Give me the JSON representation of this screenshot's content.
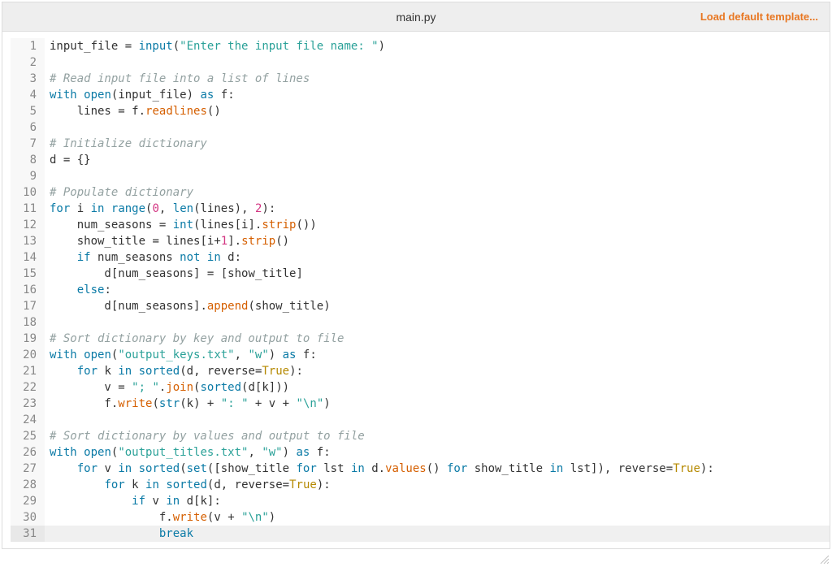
{
  "header": {
    "title": "main.py",
    "load_link": "Load default template..."
  },
  "editor": {
    "active_line": 31,
    "lines": [
      {
        "n": 1,
        "t": [
          [
            "",
            "input_file "
          ],
          [
            "op",
            "= "
          ],
          [
            "bi",
            "input"
          ],
          [
            "op",
            "("
          ],
          [
            "str",
            "\"Enter the input file name: \""
          ],
          [
            "op",
            ")"
          ]
        ]
      },
      {
        "n": 2,
        "t": [
          [
            "",
            ""
          ]
        ]
      },
      {
        "n": 3,
        "t": [
          [
            "com",
            "# Read input file into a list of lines"
          ]
        ]
      },
      {
        "n": 4,
        "t": [
          [
            "kw",
            "with"
          ],
          [
            "",
            " "
          ],
          [
            "bi",
            "open"
          ],
          [
            "op",
            "("
          ],
          [
            "",
            "input_file"
          ],
          [
            "op",
            ") "
          ],
          [
            "kw",
            "as"
          ],
          [
            "",
            " f"
          ],
          [
            "op",
            ":"
          ]
        ]
      },
      {
        "n": 5,
        "t": [
          [
            "",
            "    lines "
          ],
          [
            "op",
            "= "
          ],
          [
            "",
            "f"
          ],
          [
            "op",
            "."
          ],
          [
            "fn",
            "readlines"
          ],
          [
            "op",
            "()"
          ]
        ]
      },
      {
        "n": 6,
        "t": [
          [
            "",
            ""
          ]
        ]
      },
      {
        "n": 7,
        "t": [
          [
            "com",
            "# Initialize dictionary"
          ]
        ]
      },
      {
        "n": 8,
        "t": [
          [
            "",
            "d "
          ],
          [
            "op",
            "= {}"
          ]
        ]
      },
      {
        "n": 9,
        "t": [
          [
            "",
            ""
          ]
        ]
      },
      {
        "n": 10,
        "t": [
          [
            "com",
            "# Populate dictionary"
          ]
        ]
      },
      {
        "n": 11,
        "t": [
          [
            "kw",
            "for"
          ],
          [
            "",
            " i "
          ],
          [
            "kw",
            "in"
          ],
          [
            "",
            " "
          ],
          [
            "bi",
            "range"
          ],
          [
            "op",
            "("
          ],
          [
            "num",
            "0"
          ],
          [
            "op",
            ", "
          ],
          [
            "bi",
            "len"
          ],
          [
            "op",
            "("
          ],
          [
            "",
            "lines"
          ],
          [
            "op",
            "), "
          ],
          [
            "num",
            "2"
          ],
          [
            "op",
            "):"
          ]
        ]
      },
      {
        "n": 12,
        "t": [
          [
            "",
            "    num_seasons "
          ],
          [
            "op",
            "= "
          ],
          [
            "bi",
            "int"
          ],
          [
            "op",
            "("
          ],
          [
            "",
            "lines"
          ],
          [
            "op",
            "["
          ],
          [
            "",
            "i"
          ],
          [
            "op",
            "]."
          ],
          [
            "fn",
            "strip"
          ],
          [
            "op",
            "())"
          ]
        ]
      },
      {
        "n": 13,
        "t": [
          [
            "",
            "    show_title "
          ],
          [
            "op",
            "= "
          ],
          [
            "",
            "lines"
          ],
          [
            "op",
            "["
          ],
          [
            "",
            "i"
          ],
          [
            "op",
            "+"
          ],
          [
            "num",
            "1"
          ],
          [
            "op",
            "]."
          ],
          [
            "fn",
            "strip"
          ],
          [
            "op",
            "()"
          ]
        ]
      },
      {
        "n": 14,
        "t": [
          [
            "",
            "    "
          ],
          [
            "kw",
            "if"
          ],
          [
            "",
            " num_seasons "
          ],
          [
            "kw",
            "not"
          ],
          [
            "",
            " "
          ],
          [
            "kw",
            "in"
          ],
          [
            "",
            " d"
          ],
          [
            "op",
            ":"
          ]
        ]
      },
      {
        "n": 15,
        "t": [
          [
            "",
            "        d"
          ],
          [
            "op",
            "["
          ],
          [
            "",
            "num_seasons"
          ],
          [
            "op",
            "] = ["
          ],
          [
            "",
            "show_title"
          ],
          [
            "op",
            "]"
          ]
        ]
      },
      {
        "n": 16,
        "t": [
          [
            "",
            "    "
          ],
          [
            "kw",
            "else"
          ],
          [
            "op",
            ":"
          ]
        ]
      },
      {
        "n": 17,
        "t": [
          [
            "",
            "        d"
          ],
          [
            "op",
            "["
          ],
          [
            "",
            "num_seasons"
          ],
          [
            "op",
            "]."
          ],
          [
            "fn",
            "append"
          ],
          [
            "op",
            "("
          ],
          [
            "",
            "show_title"
          ],
          [
            "op",
            ")"
          ]
        ]
      },
      {
        "n": 18,
        "t": [
          [
            "",
            ""
          ]
        ]
      },
      {
        "n": 19,
        "t": [
          [
            "com",
            "# Sort dictionary by key and output to file"
          ]
        ]
      },
      {
        "n": 20,
        "t": [
          [
            "kw",
            "with"
          ],
          [
            "",
            " "
          ],
          [
            "bi",
            "open"
          ],
          [
            "op",
            "("
          ],
          [
            "str",
            "\"output_keys.txt\""
          ],
          [
            "op",
            ", "
          ],
          [
            "str",
            "\"w\""
          ],
          [
            "op",
            ") "
          ],
          [
            "kw",
            "as"
          ],
          [
            "",
            " f"
          ],
          [
            "op",
            ":"
          ]
        ]
      },
      {
        "n": 21,
        "t": [
          [
            "",
            "    "
          ],
          [
            "kw",
            "for"
          ],
          [
            "",
            " k "
          ],
          [
            "kw",
            "in"
          ],
          [
            "",
            " "
          ],
          [
            "bi",
            "sorted"
          ],
          [
            "op",
            "("
          ],
          [
            "",
            "d"
          ],
          [
            "op",
            ", "
          ],
          [
            "",
            "reverse"
          ],
          [
            "op",
            "="
          ],
          [
            "bool",
            "True"
          ],
          [
            "op",
            "):"
          ]
        ]
      },
      {
        "n": 22,
        "t": [
          [
            "",
            "        v "
          ],
          [
            "op",
            "= "
          ],
          [
            "str",
            "\"; \""
          ],
          [
            "op",
            "."
          ],
          [
            "fn",
            "join"
          ],
          [
            "op",
            "("
          ],
          [
            "bi",
            "sorted"
          ],
          [
            "op",
            "("
          ],
          [
            "",
            "d"
          ],
          [
            "op",
            "["
          ],
          [
            "",
            "k"
          ],
          [
            "op",
            "]))"
          ]
        ]
      },
      {
        "n": 23,
        "t": [
          [
            "",
            "        f"
          ],
          [
            "op",
            "."
          ],
          [
            "fn",
            "write"
          ],
          [
            "op",
            "("
          ],
          [
            "bi",
            "str"
          ],
          [
            "op",
            "("
          ],
          [
            "",
            "k"
          ],
          [
            "op",
            ") + "
          ],
          [
            "str",
            "\": \""
          ],
          [
            "op",
            " + "
          ],
          [
            "",
            "v"
          ],
          [
            "op",
            " + "
          ],
          [
            "str",
            "\"\\n\""
          ],
          [
            "op",
            ")"
          ]
        ]
      },
      {
        "n": 24,
        "t": [
          [
            "",
            ""
          ]
        ]
      },
      {
        "n": 25,
        "t": [
          [
            "com",
            "# Sort dictionary by values and output to file"
          ]
        ]
      },
      {
        "n": 26,
        "t": [
          [
            "kw",
            "with"
          ],
          [
            "",
            " "
          ],
          [
            "bi",
            "open"
          ],
          [
            "op",
            "("
          ],
          [
            "str",
            "\"output_titles.txt\""
          ],
          [
            "op",
            ", "
          ],
          [
            "str",
            "\"w\""
          ],
          [
            "op",
            ") "
          ],
          [
            "kw",
            "as"
          ],
          [
            "",
            " f"
          ],
          [
            "op",
            ":"
          ]
        ]
      },
      {
        "n": 27,
        "t": [
          [
            "",
            "    "
          ],
          [
            "kw",
            "for"
          ],
          [
            "",
            " v "
          ],
          [
            "kw",
            "in"
          ],
          [
            "",
            " "
          ],
          [
            "bi",
            "sorted"
          ],
          [
            "op",
            "("
          ],
          [
            "bi",
            "set"
          ],
          [
            "op",
            "(["
          ],
          [
            "",
            "show_title "
          ],
          [
            "kw",
            "for"
          ],
          [
            "",
            " lst "
          ],
          [
            "kw",
            "in"
          ],
          [
            "",
            " d"
          ],
          [
            "op",
            "."
          ],
          [
            "fn",
            "values"
          ],
          [
            "op",
            "() "
          ],
          [
            "kw",
            "for"
          ],
          [
            "",
            " show_title "
          ],
          [
            "kw",
            "in"
          ],
          [
            "",
            " lst"
          ],
          [
            "op",
            "]), "
          ],
          [
            "",
            "reverse"
          ],
          [
            "op",
            "="
          ],
          [
            "bool",
            "True"
          ],
          [
            "op",
            "):"
          ]
        ]
      },
      {
        "n": 28,
        "t": [
          [
            "",
            "        "
          ],
          [
            "kw",
            "for"
          ],
          [
            "",
            " k "
          ],
          [
            "kw",
            "in"
          ],
          [
            "",
            " "
          ],
          [
            "bi",
            "sorted"
          ],
          [
            "op",
            "("
          ],
          [
            "",
            "d"
          ],
          [
            "op",
            ", "
          ],
          [
            "",
            "reverse"
          ],
          [
            "op",
            "="
          ],
          [
            "bool",
            "True"
          ],
          [
            "op",
            "):"
          ]
        ]
      },
      {
        "n": 29,
        "t": [
          [
            "",
            "            "
          ],
          [
            "kw",
            "if"
          ],
          [
            "",
            " v "
          ],
          [
            "kw",
            "in"
          ],
          [
            "",
            " d"
          ],
          [
            "op",
            "["
          ],
          [
            "",
            "k"
          ],
          [
            "op",
            "]:"
          ]
        ]
      },
      {
        "n": 30,
        "t": [
          [
            "",
            "                f"
          ],
          [
            "op",
            "."
          ],
          [
            "fn",
            "write"
          ],
          [
            "op",
            "("
          ],
          [
            "",
            "v"
          ],
          [
            "op",
            " + "
          ],
          [
            "str",
            "\"\\n\""
          ],
          [
            "op",
            ")"
          ]
        ]
      },
      {
        "n": 31,
        "t": [
          [
            "",
            "                "
          ],
          [
            "kw",
            "break"
          ]
        ]
      }
    ]
  }
}
